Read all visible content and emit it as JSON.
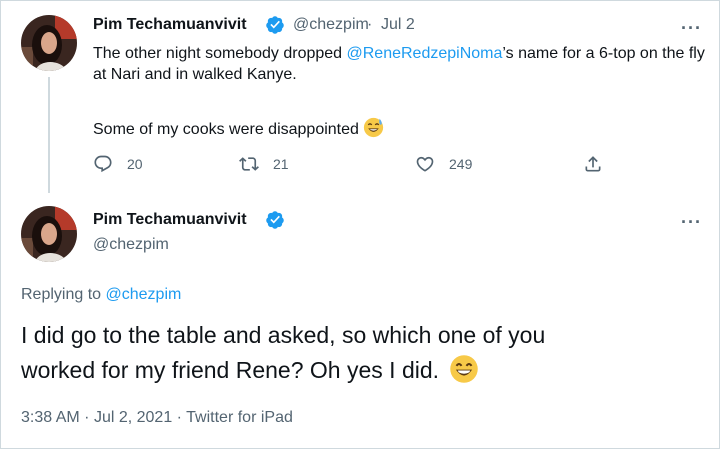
{
  "tweet1": {
    "display_name": "Pim Techamuanvivit",
    "handle": "@chezpim",
    "sep": "·",
    "date": "Jul 2",
    "text_before": "The other night somebody dropped ",
    "mention": "@ReneRedzepiNoma",
    "text_after": "’s name for a 6-top on the fly at Nari and in walked Kanye.",
    "text_line2": "Some of my cooks were disappointed",
    "emoji": "sweat-smile-emoji",
    "reply_count": "20",
    "retweet_count": "21",
    "like_count": "249"
  },
  "tweet2": {
    "display_name": "Pim Techamuanvivit",
    "handle": "@chezpim",
    "replying_prefix": "Replying to ",
    "replying_handle": "@chezpim",
    "text": "I did go to the table and asked, so which one of you worked for my friend Rene? Oh yes I did.",
    "emoji": "grin-emoji",
    "time": "3:38 AM",
    "date": "Jul 2, 2021",
    "source": "Twitter for iPad",
    "sep": "·"
  },
  "icons": {
    "more": "more-icon",
    "verified": "verified-badge-icon",
    "reply": "reply-icon",
    "retweet": "retweet-icon",
    "like": "heart-icon",
    "share": "share-icon"
  },
  "colors": {
    "link": "#1d9bf0",
    "muted": "#536471",
    "text": "#0f1419",
    "border": "#cfd9de",
    "emoji": "#f7c948"
  }
}
